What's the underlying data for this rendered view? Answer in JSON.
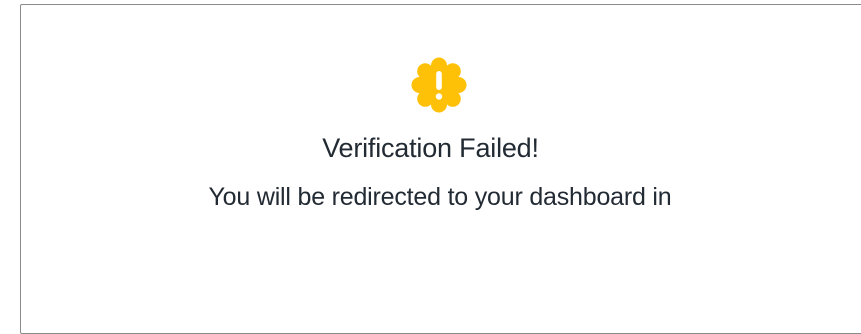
{
  "dialog": {
    "icon": "warning-badge-icon",
    "icon_color": "#FFC107",
    "title": "Verification Failed!",
    "message": "You will be redirected to your dashboard in"
  }
}
